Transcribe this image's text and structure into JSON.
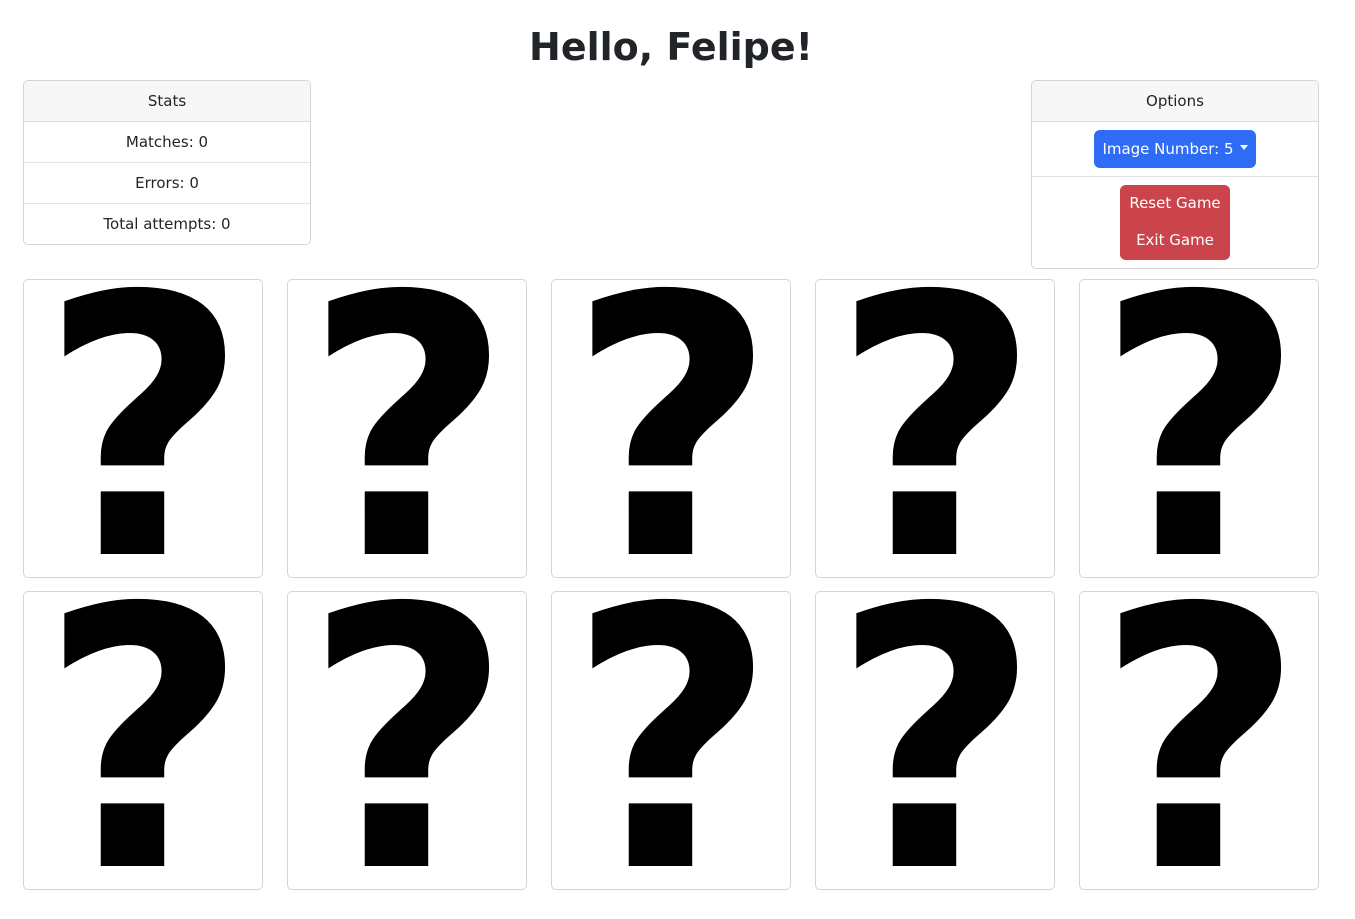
{
  "greeting": "Hello, Felipe!",
  "stats": {
    "header": "Stats",
    "matches": "Matches: 0",
    "errors": "Errors: 0",
    "total_attempts": "Total attempts: 0"
  },
  "options": {
    "header": "Options",
    "image_number_label": "Image Number: 5",
    "reset_label": "Reset Game",
    "exit_label": "Exit Game"
  },
  "card_back_symbol": "?",
  "card_back_icon": "question-mark-icon"
}
